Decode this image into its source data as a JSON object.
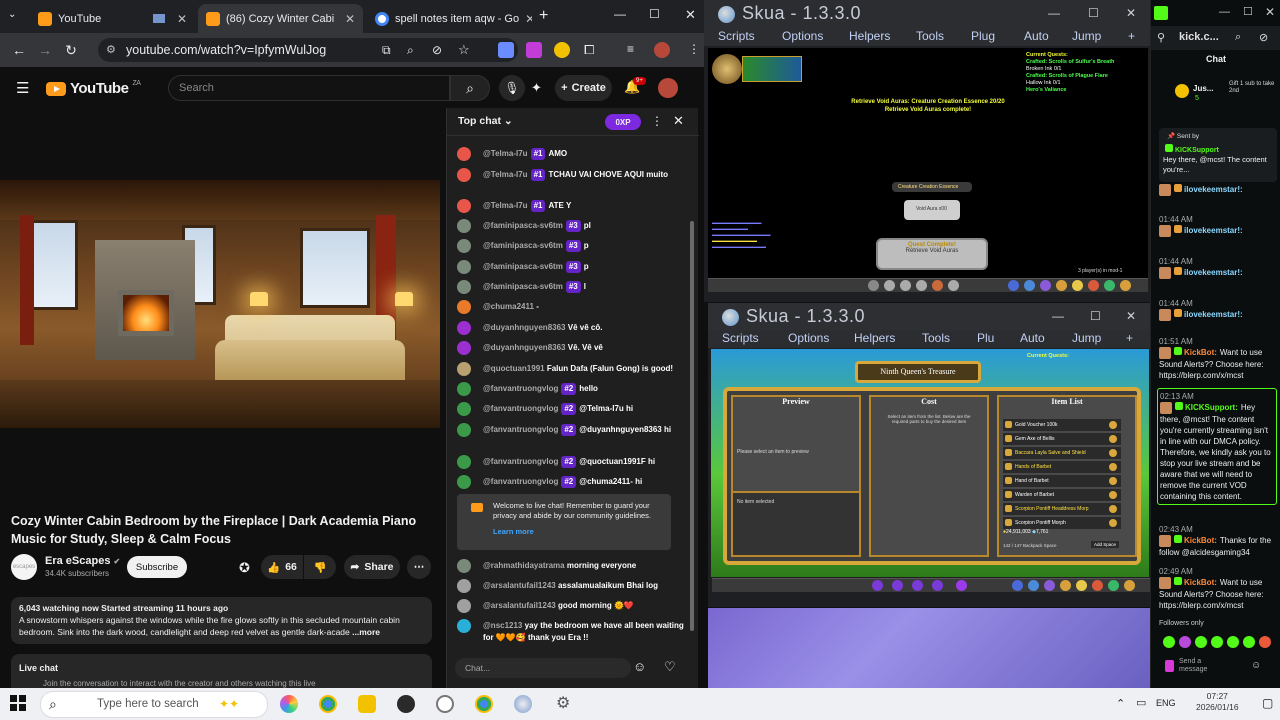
{
  "browser": {
    "tabs": [
      {
        "title": "YouTube",
        "active": false
      },
      {
        "title": "(86) Cozy Winter Cabi",
        "active": true
      },
      {
        "title": "spell notes item aqw - Go",
        "active": false
      }
    ],
    "url": "youtube.com/watch?v=IpfymWulJog"
  },
  "youtube": {
    "logo_text": "YouTube",
    "logo_region": "ZA",
    "search_placeholder": "Search",
    "create_label": "Create",
    "notif_count": "9+",
    "video_title": "Cozy Winter Cabin Bedroom by the Fireplace | Dark Academia Piano Music for Study, Sleep & Calm Focus",
    "channel": {
      "name": "Era eScapes",
      "subs": "34.4K subscribers",
      "avatar_text": "escapes"
    },
    "subscribe_label": "Subscribe",
    "likes": "66",
    "share_label": "Share",
    "stats": "6,043 watching now  Started streaming 11 hours ago",
    "description": "A snowstorm whispers against the windows while the fire glows softly in this secluded mountain cabin bedroom. Sink into the dark wood, candlelight and deep red velvet as gentle dark-acade",
    "more_label": "...more",
    "live_chat_title": "Live chat",
    "live_chat_sub": "Join the conversation to interact with the creator and others watching this live"
  },
  "chat": {
    "header": "Top chat",
    "xp": "0XP",
    "messages": [
      {
        "user": "@Telma-I7u",
        "badge": "#1",
        "text": "AMO",
        "color": "#e8564a"
      },
      {
        "user": "@Telma-I7u",
        "badge": "#1",
        "text": "TCHAU VAI CHOVE AQUI muito",
        "color": "#e8564a"
      },
      {
        "user": "@Telma-I7u",
        "badge": "#1",
        "text": "ATE Y",
        "color": "#e8564a"
      },
      {
        "user": "@faminipasca-sv6tm",
        "badge": "#3",
        "text": "pl",
        "color": "#7a8a7a"
      },
      {
        "user": "@faminipasca-sv6tm",
        "badge": "#3",
        "text": "p",
        "color": "#7a8a7a"
      },
      {
        "user": "@faminipasca-sv6tm",
        "badge": "#3",
        "text": "p",
        "color": "#7a8a7a"
      },
      {
        "user": "@faminipasca-sv6tm",
        "badge": "#3",
        "text": "l",
        "color": "#7a8a7a"
      },
      {
        "user": "@chuma2411",
        "badge": "",
        "text": "-",
        "color": "#e87a2a"
      },
      {
        "user": "@duyanhnguyen8363",
        "badge": "",
        "text": "Vê vê cô.",
        "color": "#9b2fd0"
      },
      {
        "user": "@duyanhnguyen8363",
        "badge": "",
        "text": "Vê. Vê vê",
        "color": "#9b2fd0"
      },
      {
        "user": "@quoctuan1991",
        "badge": "",
        "text": "Falun Dafa (Falun Gong) is good!",
        "color": "#b8a070"
      },
      {
        "user": "@fanvantruongvlog",
        "badge": "#2",
        "text": "hello",
        "color": "#3a9a4a"
      },
      {
        "user": "@fanvantruongvlog",
        "badge": "#2",
        "text": "@Telma-I7u hi",
        "color": "#3a9a4a"
      },
      {
        "user": "@fanvantruongvlog",
        "badge": "#2",
        "text": "@duyanhnguyen8363 hi",
        "color": "#3a9a4a"
      },
      {
        "user": "@fanvantruongvlog",
        "badge": "#2",
        "text": "@quoctuan1991F hi",
        "color": "#3a9a4a"
      },
      {
        "user": "@fanvantruongvlog",
        "badge": "#2",
        "text": "@chuma2411- hi",
        "color": "#3a9a4a"
      }
    ],
    "welcome_text": "Welcome to live chat! Remember to guard your privacy and abide by our community guidelines.",
    "learn_more": "Learn more",
    "messages_after": [
      {
        "user": "@rahmathidayatrama",
        "text": "morning everyone",
        "color": "#7a8a7a"
      },
      {
        "user": "@arsalantufail1243",
        "text": "assalamualaikum Bhai log",
        "color": "#a0a0a0"
      },
      {
        "user": "@arsalantufail1243",
        "text": "good morning 🌞❤️",
        "color": "#a0a0a0"
      },
      {
        "user": "@nsc1213",
        "text": "yay the bedroom we have all been waiting for 🧡🧡🥰 thank you Era !!",
        "color": "#2ab0d8"
      }
    ],
    "input_placeholder": "Chat..."
  },
  "skua1": {
    "title": "Skua - 1.3.3.0",
    "menu": [
      "Scripts",
      "Options",
      "Helpers",
      "Tools",
      "Plug",
      "Auto",
      "Jump",
      "+"
    ],
    "quests_title": "Current Quests:",
    "quests": [
      "Crafted: Scrolls of Sulfur's Breath",
      "Broken Ink 0/1",
      "Crafted: Scrolls of Plague Flare",
      "Hallow Ink 0/1",
      "Hero's Valiance"
    ],
    "quest_lines": [
      "Retrieve Void Auras: Creature Creation Essence 20/20",
      "Retrieve Void Auras complete!"
    ],
    "item_popup": "Creature Creation Essence",
    "item_popup2": "Void Aura x00",
    "quest_complete": "Quest Complete!",
    "quest_complete_sub": "Retrieve Void Auras",
    "players": "3 player(s) in mod-1"
  },
  "skua2": {
    "title": "Skua - 1.3.3.0",
    "menu": [
      "Scripts",
      "Options",
      "Helpers",
      "Tools",
      "Plu",
      "Auto",
      "Jump",
      "+"
    ],
    "shop_title": "Ninth Queen's Treasure",
    "preview": "Preview",
    "cost": "Cost",
    "item_list": "Item List",
    "preview_text": "Please select an item to preview",
    "no_item": "No item selected",
    "cost_text": "Select an item from the list. Below are the required parts to buy the desired item",
    "items": [
      "Gold Voucher 100k",
      "Gem Axe of Bellis",
      "Baccara Layla Salve and Shield",
      "Hands of Barbet",
      "Hand of Barbet",
      "Warden of Barbet",
      "Scorpion Pontiff Headdress Morp",
      "Scorpion Pontiff Morph"
    ],
    "gold": "24,911,003",
    "ac": "7,761",
    "backpack": "142 / 147 Backpack Space",
    "add_space": "Add Space"
  },
  "kick": {
    "url": "kick.c...",
    "chat_title": "Chat",
    "gift_user": "Jus...",
    "gift_count": "5",
    "gift_text": "Gift 1 sub to take 2nd",
    "pinned_by": "Sent by",
    "pinned_user": "KICKSupport",
    "pinned_text": "Hey there, @mcst! The content you're...",
    "messages": [
      {
        "time": "",
        "user": "ilovekeemstar!:",
        "text": ""
      },
      {
        "time": "01:44 AM",
        "user": "ilovekeemstar!:",
        "text": ""
      },
      {
        "time": "01:44 AM",
        "user": "ilovekeemstar!:",
        "text": ""
      },
      {
        "time": "01:44 AM",
        "user": "ilovekeemstar!:",
        "text": ""
      },
      {
        "time": "01:51 AM",
        "user": "KickBot:",
        "text": "Want to use Sound Alerts?? Choose here: https://blerp.com/x/mcst"
      },
      {
        "time": "02:13 AM",
        "user": "KICKSupport:",
        "text": "Hey there, @mcst! The content you're currently streaming isn't in line with our DMCA policy. Therefore, we kindly ask you to stop your live stream and be aware that we will need to remove the current VOD containing this content."
      },
      {
        "time": "02:43 AM",
        "user": "KickBot:",
        "text": "Thanks for the follow @alcidesgaming34"
      },
      {
        "time": "02:49 AM",
        "user": "KickBot:",
        "text": "Want to use Sound Alerts?? Choose here: https://blerp.com/x/mcst"
      }
    ],
    "followers_only": "Followers only",
    "send_placeholder": "Send a message"
  },
  "taskbar": {
    "search_placeholder": "Type here to search",
    "lang": "ENG",
    "time": "07:27",
    "date": "2026/01/16"
  }
}
